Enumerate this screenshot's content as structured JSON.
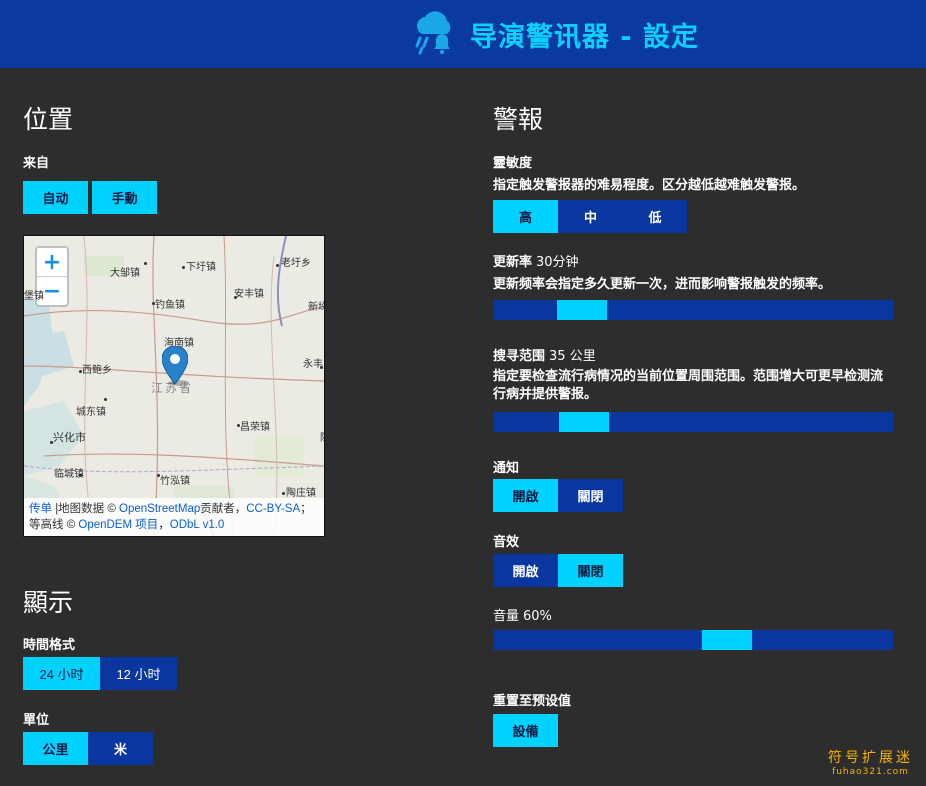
{
  "header": {
    "title": "导演警讯器 - 設定",
    "icon": "rain-bell-icon"
  },
  "location": {
    "heading": "位置",
    "source_label": "来自",
    "auto_label": "自动",
    "manual_label": "手動",
    "map": {
      "zoom_in": "+",
      "zoom_out": "−",
      "places": [
        "大邹镇",
        "下圩镇",
        "老圩乡",
        "新垛",
        "堡镇",
        "安丰镇",
        "钓鱼镇",
        "海南镇",
        "永丰",
        "西鲍乡",
        "江苏省",
        "城东镇",
        "兴化市",
        "昌荣镇",
        "临城镇",
        "竹泓镇",
        "陶庄镇",
        "陈"
      ],
      "attribution": {
        "leaflet": "传单",
        "part1": " |地图数据 © ",
        "osm": "OpenStreetMap",
        "part2": "贡献者，",
        "ccbysa": "CC-BY-SA",
        "part3": "；等高线 © ",
        "opendem": "OpenDEM 项目",
        "part4": "，",
        "odbl": "ODbL v1.0"
      }
    }
  },
  "display": {
    "heading": "顯示",
    "time_label": "時間格式",
    "time_24": "24 小时",
    "time_12": "12 小时",
    "unit_label": "單位",
    "unit_km": "公里",
    "unit_mile": "米"
  },
  "alerts": {
    "heading": "警報",
    "sensitivity": {
      "label": "靈敏度",
      "desc": "指定触发警报器的难易程度。区分越低越难触发警报。",
      "high": "高",
      "medium": "中",
      "low": "低"
    },
    "refresh": {
      "label": "更新率",
      "value": "30分钟",
      "desc": "更新频率会指定多久更新一次，进而影响警报触发的频率。",
      "level": 0.125
    },
    "range": {
      "label": "搜寻范围",
      "value": "35 公里",
      "desc": "指定要检查流行病情况的当前位置周围范围。范围增大可更早检测流行病并提供警报。",
      "level": 0.16
    },
    "notify": {
      "label": "通知",
      "on": "開啟",
      "off": "關閉"
    },
    "sound": {
      "label": "音效",
      "on": "開啟",
      "off": "關閉"
    },
    "volume": {
      "label": "音量",
      "value": "60%",
      "level": 0.6
    },
    "reset": {
      "label": "重置至预设值",
      "button": "設備"
    }
  },
  "watermark": {
    "line1": "符号扩展迷",
    "line2": "fuhao321.com"
  },
  "colors": {
    "accent": "#00d2ff",
    "primary": "#0a36a0",
    "background": "#2d2d2d"
  }
}
